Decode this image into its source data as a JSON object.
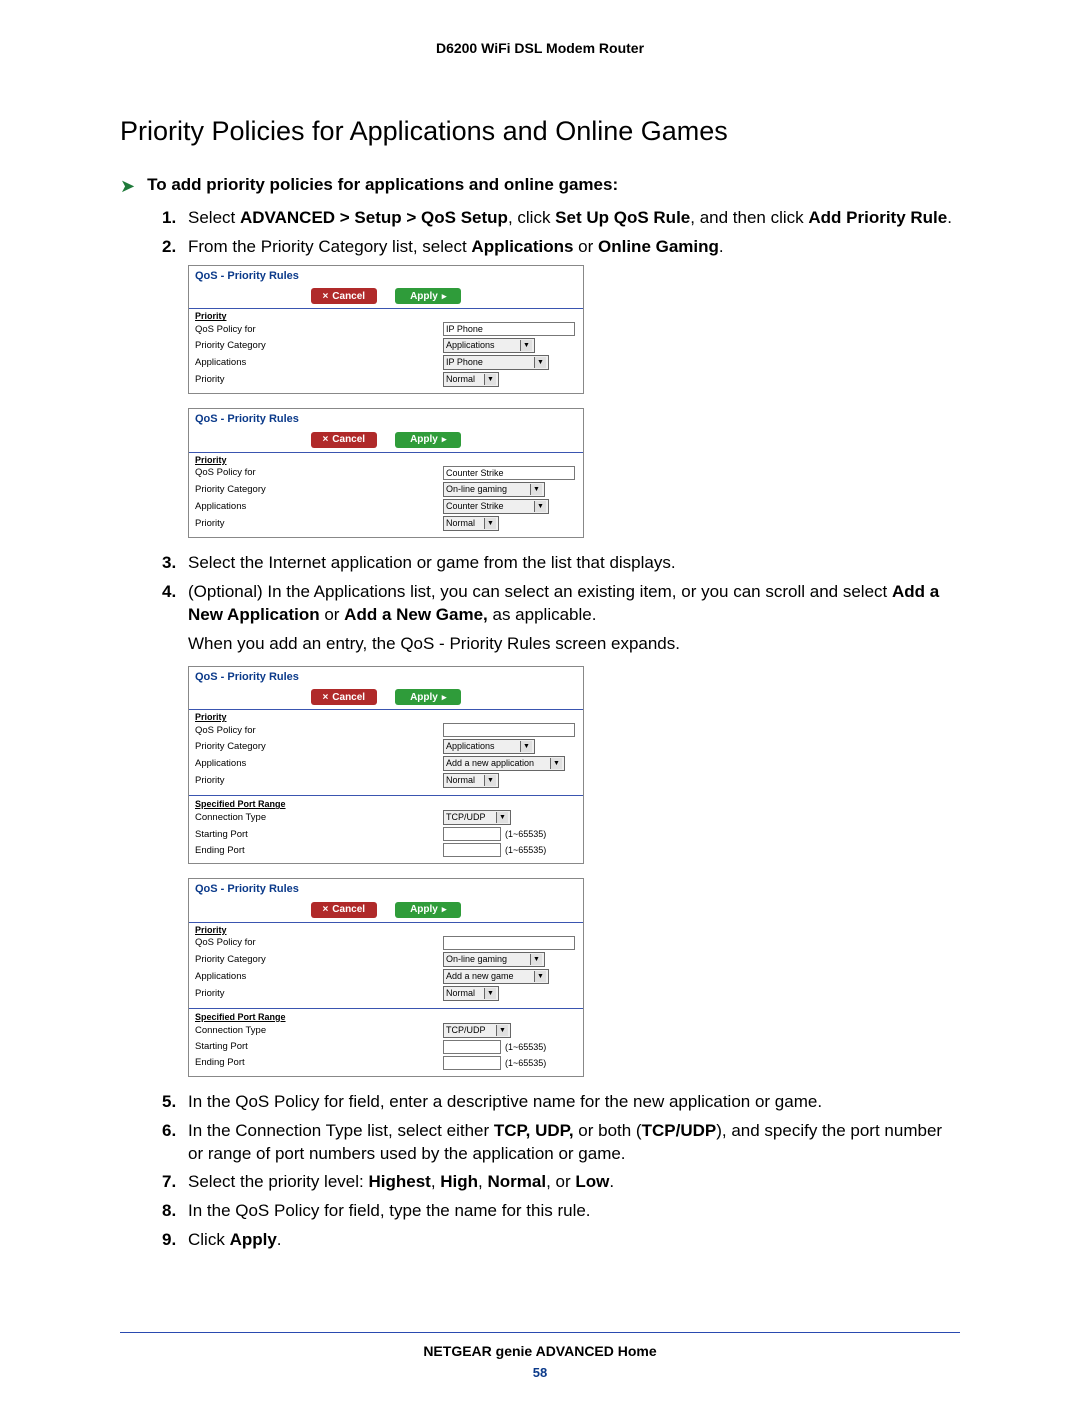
{
  "header": {
    "title": "D6200 WiFi DSL Modem Router"
  },
  "section": {
    "title": "Priority Policies for Applications and Online Games"
  },
  "lead": "To add priority policies for applications and online games:",
  "step1": {
    "pre": "Select ",
    "b1": "ADVANCED > Setup > QoS Setup",
    "mid1": ", click ",
    "b2": "Set Up QoS Rule",
    "mid2": ", and then click ",
    "b3": "Add Priority Rule",
    "post": "."
  },
  "step2": {
    "pre": "From the Priority Category list, select ",
    "b1": "Applications",
    "mid": " or ",
    "b2": "Online Gaming",
    "post": "."
  },
  "step3": "Select the Internet application or game from the list that displays.",
  "step4": {
    "pre": "(Optional) In the Applications list, you can select an existing item, or you can scroll and select ",
    "b1": "Add a New Application",
    "mid": " or ",
    "b2": "Add a New Game,",
    "post": " as applicable."
  },
  "step4_sub": "When you add an entry, the QoS - Priority Rules screen expands.",
  "step5": "In the QoS Policy for field, enter a descriptive name for the new application or game.",
  "step6": {
    "pre": "In the Connection Type list, select either ",
    "b1": "TCP, UDP,",
    "mid": " or both (",
    "b2": "TCP/UDP",
    "post": "), and specify the port number or range of port numbers used by the application or game."
  },
  "step7": {
    "pre": "Select the priority level: ",
    "b1": "Highest",
    "c1": ", ",
    "b2": "High",
    "c2": ", ",
    "b3": "Normal",
    "c3": ", or ",
    "b4": "Low",
    "post": "."
  },
  "step8": "In the QoS Policy for field, type the name for this rule.",
  "step9": {
    "pre": "Click ",
    "b1": "Apply",
    "post": "."
  },
  "panel": {
    "title": "QoS - Priority Rules",
    "cancel": "Cancel",
    "apply": "Apply",
    "priority_hdr": "Priority",
    "port_hdr": "Specified Port Range",
    "labels": {
      "policy_for": "QoS Policy for",
      "category": "Priority Category",
      "apps": "Applications",
      "priority": "Priority",
      "conn_type": "Connection Type",
      "start_port": "Starting Port",
      "end_port": "Ending Port"
    },
    "values": {
      "ip_phone": "IP Phone",
      "applications": "Applications",
      "normal": "Normal",
      "counter_strike": "Counter Strike",
      "online_gaming": "On-line gaming",
      "add_new_app": "Add a new application",
      "add_new_game": "Add a new game",
      "tcp_udp": "TCP/UDP",
      "port_hint": "(1~65535)"
    }
  },
  "footer": {
    "title": "NETGEAR genie ADVANCED Home",
    "page": "58"
  }
}
